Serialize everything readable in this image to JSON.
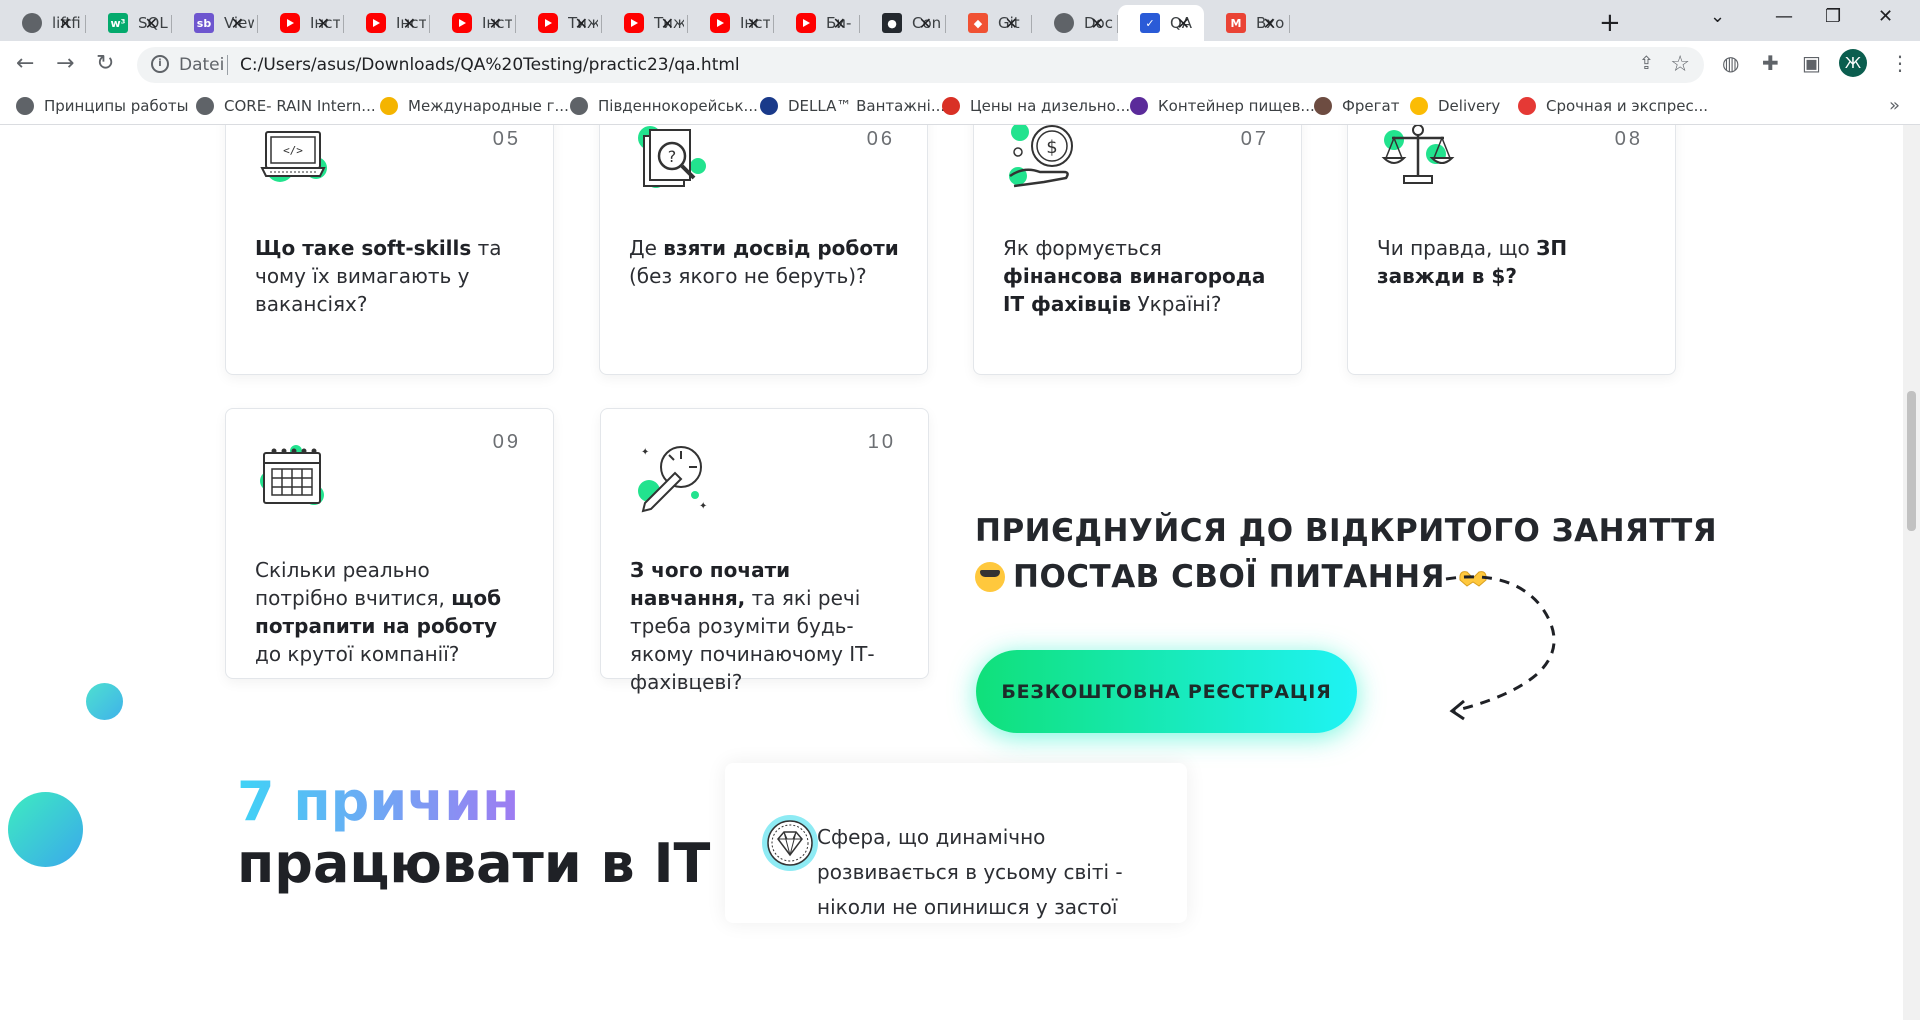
{
  "browser": {
    "tabs": [
      {
        "label": "liftfi",
        "icon": "globe-icon"
      },
      {
        "label": "SQL",
        "icon": "w3schools-icon"
      },
      {
        "label": "View",
        "icon": "storybook-icon"
      },
      {
        "label": "Інст",
        "icon": "youtube-icon"
      },
      {
        "label": "Інст",
        "icon": "youtube-icon"
      },
      {
        "label": "Інст",
        "icon": "youtube-icon"
      },
      {
        "label": "Тиж",
        "icon": "youtube-icon"
      },
      {
        "label": "Тиж",
        "icon": "youtube-icon"
      },
      {
        "label": "Інст",
        "icon": "youtube-icon"
      },
      {
        "label": "Би-",
        "icon": "youtube-icon"
      },
      {
        "label": "Con",
        "icon": "github-icon"
      },
      {
        "label": "Git",
        "icon": "git-icon"
      },
      {
        "label": "Doc",
        "icon": "globe-icon"
      },
      {
        "label": "QA",
        "icon": "qa-icon",
        "active": true
      },
      {
        "label": "Вхо",
        "icon": "gmail-icon"
      }
    ],
    "address": {
      "scheme_label": "Datei",
      "url": "C:/Users/asus/Downloads/QA%20Testing/practic23/qa.html"
    },
    "profile_initial": "Ж",
    "bookmarks": [
      {
        "label": "Принципы работы"
      },
      {
        "label": "CORE- RAIN Intern..."
      },
      {
        "label": "Международные г..."
      },
      {
        "label": "Південнокорейськ..."
      },
      {
        "label": "DELLA™ Вантажні..."
      },
      {
        "label": "Цены на дизельно..."
      },
      {
        "label": "Контейнер пищев..."
      },
      {
        "label": "Фрегат"
      },
      {
        "label": "Delivery"
      },
      {
        "label": "Срочная и экспрес..."
      }
    ]
  },
  "cards": [
    {
      "num": "05",
      "parts": [
        {
          "b": true,
          "t": "Що таке soft-skills"
        },
        {
          "b": false,
          "t": " та чому їх вимагають у вакансіях?"
        }
      ]
    },
    {
      "num": "06",
      "parts": [
        {
          "b": false,
          "t": "Де "
        },
        {
          "b": true,
          "t": "взяти досвід роботи"
        },
        {
          "b": false,
          "t": " (без якого не беруть)?"
        }
      ]
    },
    {
      "num": "07",
      "parts": [
        {
          "b": false,
          "t": "Як формується "
        },
        {
          "b": true,
          "t": "фінансова винагорода ІТ фахівців"
        },
        {
          "b": false,
          "t": " Україні?"
        }
      ]
    },
    {
      "num": "08",
      "parts": [
        {
          "b": false,
          "t": "Чи правда, що "
        },
        {
          "b": true,
          "t": "ЗП завжди в $?"
        }
      ]
    },
    {
      "num": "09",
      "parts": [
        {
          "b": false,
          "t": "Скільки реально потрібно вчитися, "
        },
        {
          "b": true,
          "t": "щоб потрапити на роботу"
        },
        {
          "b": false,
          "t": " до крутої компанії?"
        }
      ]
    },
    {
      "num": "10",
      "parts": [
        {
          "b": true,
          "t": "З чого почати навчання,"
        },
        {
          "b": false,
          "t": " та які речі треба розуміти будь-якому починаючому ІТ-фахівцеві?"
        }
      ]
    }
  ],
  "cta": {
    "line1": "ПРИЄДНУЙСЯ ДО ВІДКРИТОГО ЗАНЯТТЯ",
    "line2": "ПОСТАВ СВОЇ ПИТАННЯ",
    "button": "БЕЗКОШТОВНА РЕЄСТРАЦІЯ"
  },
  "reasons": {
    "title_accent": "7 причин",
    "title_rest": "працювати в IT",
    "first_item": "Сфера, що динамічно розвивається в усьому світі - ніколи не опинишся у застої"
  }
}
